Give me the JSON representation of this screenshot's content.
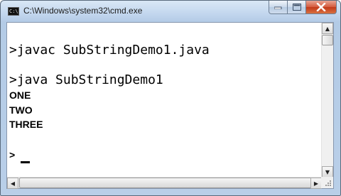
{
  "window": {
    "title": "C:\\Windows\\system32\\cmd.exe",
    "icon_text": "C:\\"
  },
  "caption": {
    "minimize_glyph": "—",
    "maximize_glyph": "□",
    "close_glyph": "✕"
  },
  "console": {
    "lines": [
      ">javac SubStringDemo1.java",
      ">java SubStringDemo1",
      "ONE",
      "TWO",
      "THREE",
      ">"
    ]
  },
  "scroll": {
    "up": "▲",
    "down": "▼",
    "left": "◀",
    "right": "▶"
  }
}
